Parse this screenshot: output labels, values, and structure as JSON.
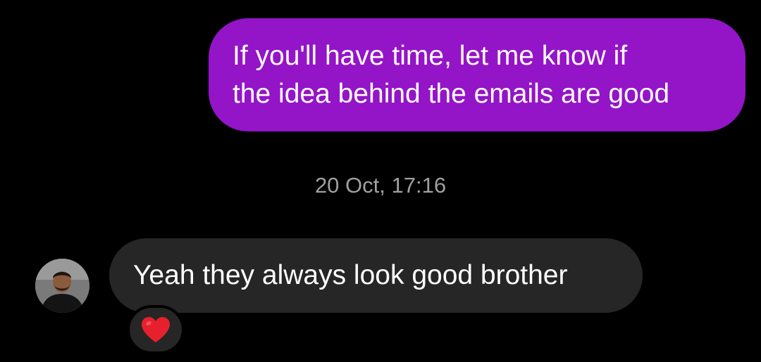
{
  "messages": [
    {
      "direction": "outgoing",
      "text": "If you'll have time, let me know if\nthe idea behind the emails are good"
    },
    {
      "direction": "incoming",
      "text": "Yeah they always look good brother",
      "reaction": "heart-icon"
    }
  ],
  "timestamp": "20 Oct, 17:16",
  "colors": {
    "background": "#000000",
    "outgoing_bubble": "#9414c8",
    "incoming_bubble": "#262626",
    "timestamp_text": "#a0a0a0",
    "reaction_heart": "#e8202e"
  }
}
